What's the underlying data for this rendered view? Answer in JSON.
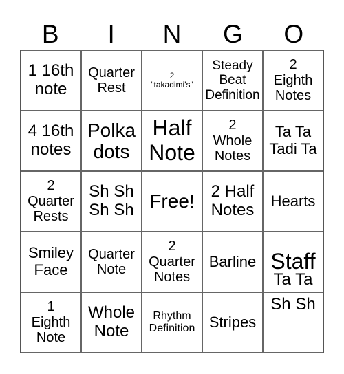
{
  "header": {
    "letters": [
      "B",
      "I",
      "N",
      "G",
      "O"
    ]
  },
  "cells": [
    [
      "1 16th note",
      "Quarter Rest",
      "2 \"takadimi's\"",
      "Steady Beat Definition",
      "2 Eighth Notes"
    ],
    [
      "4 16th notes",
      "Polka dots",
      "Half Note",
      "2 Whole Notes",
      "Ta Ta Tadi Ta"
    ],
    [
      "2 Quarter Rests",
      "Sh Sh Sh Sh",
      "Free!",
      "2 Half Notes",
      "Hearts"
    ],
    [
      "Smiley Face",
      "Quarter Note",
      "2 Quarter Notes",
      "Barline",
      "Staff Ta Ta Sh Sh"
    ],
    [
      "1 Eighth Note",
      "Whole Note",
      "Rhythm Definition",
      "Stripes",
      ""
    ]
  ],
  "lines": {
    "r0c0": [
      "1 16th",
      "note"
    ],
    "r0c1": [
      "Quarter",
      "Rest"
    ],
    "r0c2": [
      "2",
      "\"takadimi's\""
    ],
    "r0c3": [
      "Steady",
      "Beat",
      "Definition"
    ],
    "r0c4": [
      "2",
      "Eighth",
      "Notes"
    ],
    "r1c0": [
      "4 16th",
      "notes"
    ],
    "r1c1": [
      "Polka",
      "dots"
    ],
    "r1c2": [
      "Half",
      "Note"
    ],
    "r1c3": [
      "2",
      "Whole",
      "Notes"
    ],
    "r1c4": [
      "Ta Ta",
      "Tadi Ta"
    ],
    "r2c0": [
      "2",
      "Quarter",
      "Rests"
    ],
    "r2c1": [
      "Sh Sh",
      "Sh Sh"
    ],
    "r2c2": [
      "Free!"
    ],
    "r2c3": [
      "2 Half",
      "Notes"
    ],
    "r2c4": [
      "Hearts"
    ],
    "r3c0": [
      "Smiley",
      "Face"
    ],
    "r3c1": [
      "Quarter",
      "Note"
    ],
    "r3c2": [
      "2",
      "Quarter",
      "Notes"
    ],
    "r3c3": [
      "Barline"
    ],
    "r3c4": [
      "Staff",
      "Ta Ta",
      "Sh Sh"
    ],
    "r4c0": [
      "1",
      "Eighth",
      "Note"
    ],
    "r4c1": [
      "Whole",
      "Note"
    ],
    "r4c2": [
      "Rhythm",
      "Definition"
    ],
    "r4c3": [
      "Stripes"
    ],
    "r4c4": []
  }
}
